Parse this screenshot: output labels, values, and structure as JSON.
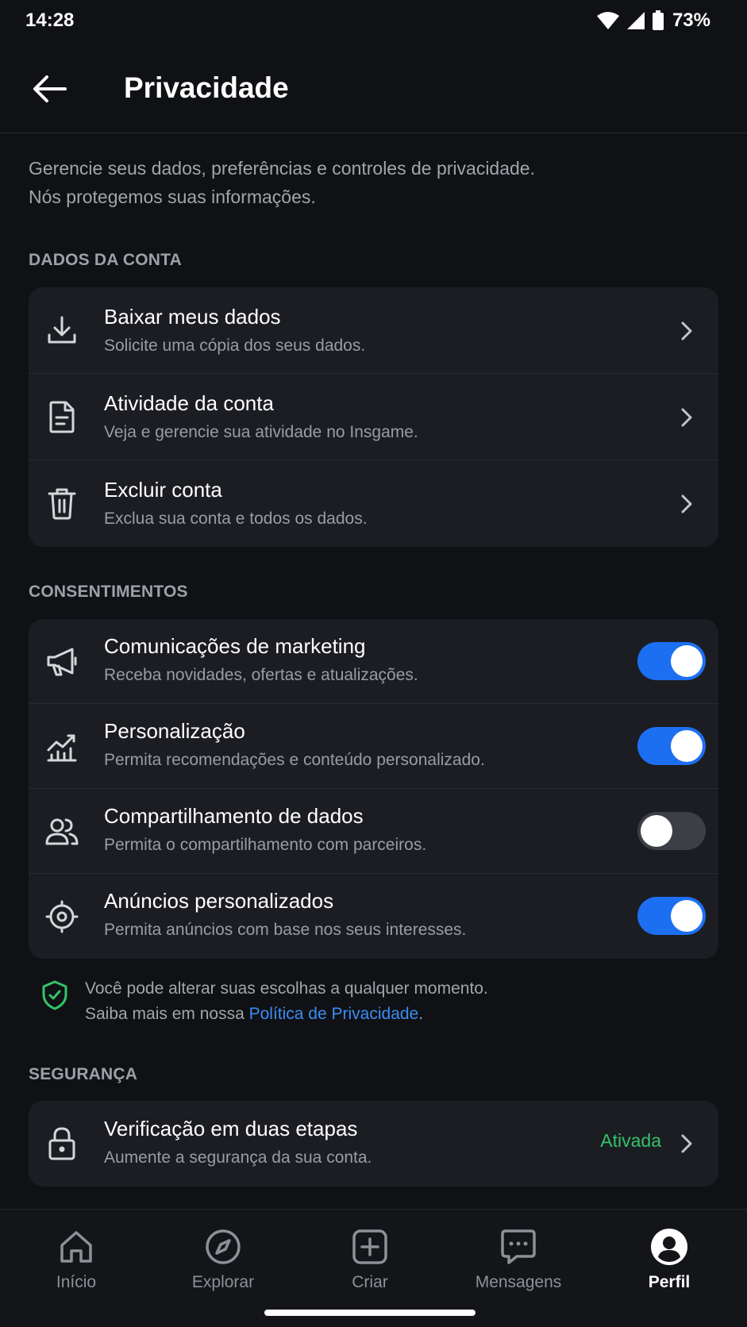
{
  "status_bar": {
    "time": "14:28",
    "battery": "73%"
  },
  "header": {
    "title": "Privacidade"
  },
  "intro": {
    "line1": "Gerencie seus dados, preferências e controles de privacidade.",
    "line2": "Nós protegemos suas informações."
  },
  "sections": {
    "account": {
      "label": "DADOS DA CONTA",
      "items": [
        {
          "title": "Baixar meus dados",
          "subtitle": "Solicite uma cópia dos seus dados.",
          "icon": "download-icon"
        },
        {
          "title": "Atividade da conta",
          "subtitle": "Veja e gerencie sua atividade no Insgame.",
          "icon": "document-icon"
        },
        {
          "title": "Excluir conta",
          "subtitle": "Exclua sua conta e todos os dados.",
          "icon": "trash-icon"
        }
      ]
    },
    "consents": {
      "label": "CONSENTIMENTOS",
      "items": [
        {
          "title": "Comunicações de marketing",
          "subtitle": "Receba novidades, ofertas e atualizações.",
          "icon": "megaphone-icon",
          "enabled": true
        },
        {
          "title": "Personalização",
          "subtitle": "Permita recomendações e conteúdo personalizado.",
          "icon": "chart-icon",
          "enabled": true
        },
        {
          "title": "Compartilhamento de dados",
          "subtitle": "Permita o compartilhamento com parceiros.",
          "icon": "users-icon",
          "enabled": false
        },
        {
          "title": "Anúncios personalizados",
          "subtitle": "Permita anúncios com base nos seus interesses.",
          "icon": "target-icon",
          "enabled": true
        }
      ]
    },
    "security": {
      "label": "SEGURANÇA",
      "items": [
        {
          "title": "Verificação em duas etapas",
          "subtitle": "Aumente a segurança da sua conta.",
          "icon": "lock-icon",
          "status": "Ativada"
        }
      ]
    }
  },
  "note": {
    "line1": "Você pode alterar suas escolhas a qualquer momento.",
    "line2_prefix": "Saiba mais em nossa ",
    "link": "Política de Privacidade",
    "line2_suffix": "."
  },
  "bottom_nav": [
    {
      "label": "Início",
      "icon": "home-icon",
      "active": false
    },
    {
      "label": "Explorar",
      "icon": "compass-icon",
      "active": false
    },
    {
      "label": "Criar",
      "icon": "plus-square-icon",
      "active": false
    },
    {
      "label": "Mensagens",
      "icon": "chat-icon",
      "active": false
    },
    {
      "label": "Perfil",
      "icon": "profile-icon",
      "active": true
    }
  ],
  "colors": {
    "background": "#101114",
    "card": "#1c1d22",
    "accent": "#1d6ff2",
    "link": "#3b8cf5",
    "success": "#34c26b"
  }
}
